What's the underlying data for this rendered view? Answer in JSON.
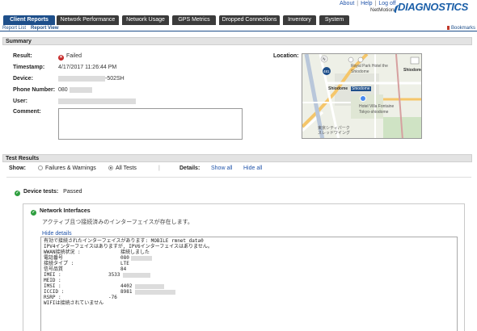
{
  "header": {
    "links": [
      "About",
      "Help",
      "Log off"
    ],
    "brand_small": "NetMotion",
    "brand_large": "DIAGNOSTICS",
    "brand_color": "#1b5fa8"
  },
  "tabs": [
    {
      "label": "Client Reports",
      "active": true
    },
    {
      "label": "Network Performance",
      "active": false
    },
    {
      "label": "Network Usage",
      "active": false
    },
    {
      "label": "GPS Metrics",
      "active": false
    },
    {
      "label": "Dropped Connections",
      "active": false
    },
    {
      "label": "Inventory",
      "active": false
    },
    {
      "label": "System",
      "active": false
    }
  ],
  "subnav": {
    "items": [
      "Report List",
      "Report View"
    ],
    "bookmarks": "Bookmarks"
  },
  "summary": {
    "title": "Summary",
    "result_label": "Result:",
    "result_value": "Failed",
    "timestamp_label": "Timestamp:",
    "timestamp_value": "4/17/2017 11:26:44 PM",
    "device_label": "Device:",
    "device_value_suffix": "-502SH",
    "phone_label": "Phone Number:",
    "phone_value_prefix": "080",
    "user_label": "User:",
    "comment_label": "Comment:",
    "location_label": "Location:",
    "map_labels": [
      "Royal Park Hotel the Shiodome",
      "Shiodome",
      "Shiodome",
      "Hotel Villa Fontaine Tokyo-shiodome",
      "Shiodome",
      "Yurikamome Line",
      "東京シティパーク スレッドワイング",
      "481"
    ]
  },
  "test_results": {
    "title": "Test Results",
    "show_label": "Show:",
    "option_failures": "Failures & Warnings",
    "option_all": "All Tests",
    "details_label": "Details:",
    "show_all": "Show all",
    "hide_all": "Hide all",
    "device_tests_label": "Device tests:",
    "device_tests_value": "Passed",
    "network_interfaces_title": "Network Interfaces",
    "network_interfaces_desc": "アクティブ且つ接続済みのインターフェイスが存在します。",
    "hide_details": "Hide details",
    "details_lines": [
      "有効で接続されたインターフェイスがあります: MOBILE rmnet_data0",
      "",
      "IPV4インターフェイスはありますが, IPV6インターフェイスはありません。",
      "",
      "WWAN接続状況 :",
      "電話番号",
      "接続タイプ :",
      "信号品質",
      "IMEI :",
      "MEID :",
      "IMSI :",
      "ICCID :",
      "RSRP :",
      "",
      "",
      "WIFIは接続されていません"
    ],
    "details_values": [
      "接続しました",
      "080",
      "LTE",
      "84",
      "3533",
      "",
      "4402",
      "8981",
      "-76"
    ]
  },
  "colors": {
    "tab_active": "#1e4f8a",
    "tab_inactive": "#3b3b3b",
    "failed_icon": "#c62828",
    "passed_icon": "#2e9e3e",
    "link": "#2255aa"
  }
}
